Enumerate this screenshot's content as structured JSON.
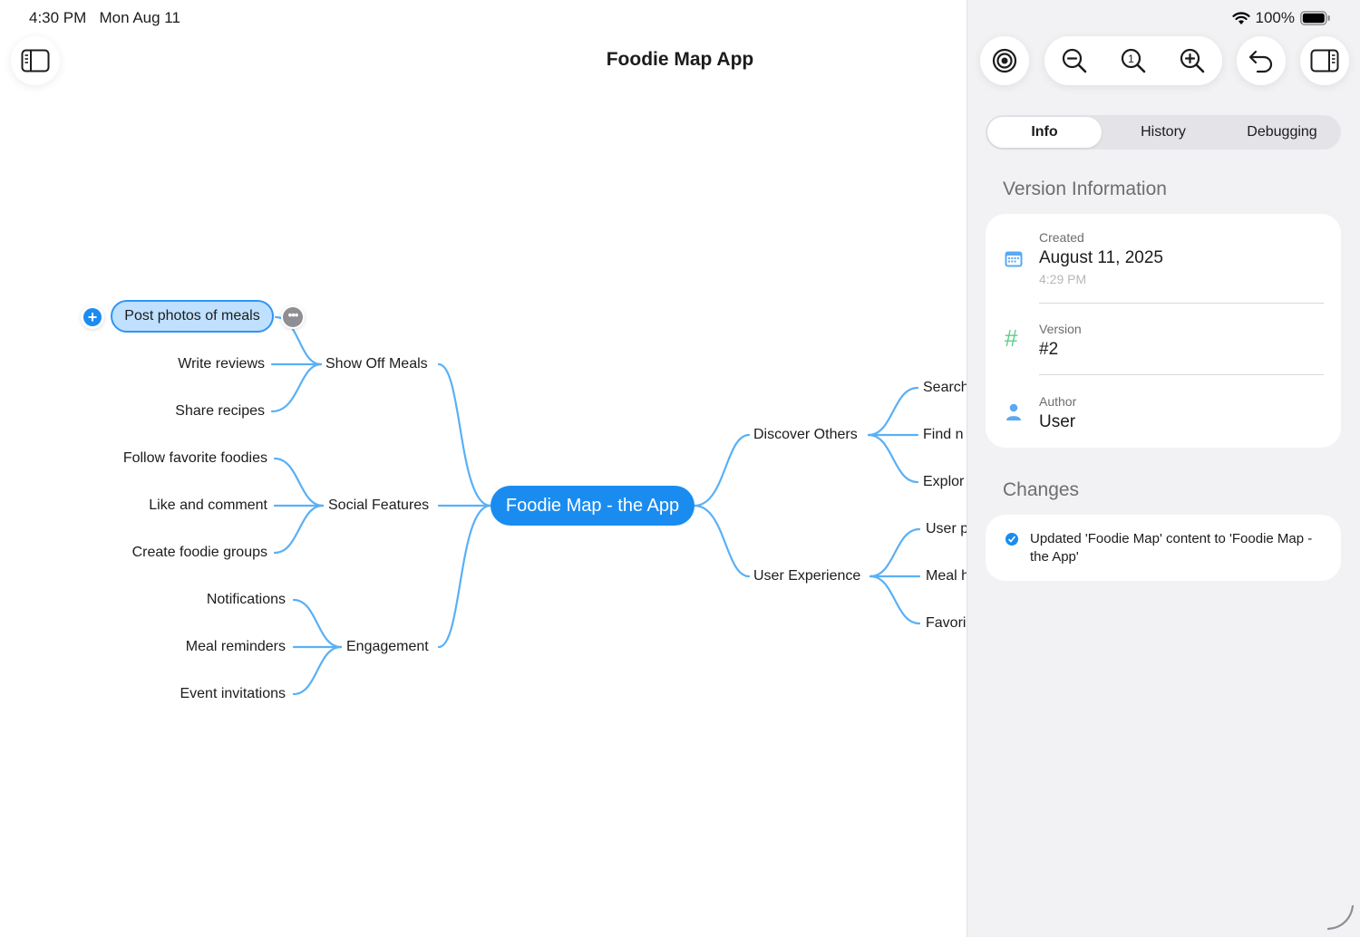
{
  "status_bar": {
    "time": "4:30 PM",
    "date": "Mon Aug 11",
    "battery": "100%"
  },
  "toolbar": {
    "left_icon": "sidebar-icon",
    "title": "Foodie Map App",
    "right_icons": [
      "focus-target-icon",
      "zoom-out-icon",
      "zoom-actual-size-icon",
      "zoom-in-icon",
      "undo-icon",
      "inspector-panel-icon"
    ]
  },
  "mindmap": {
    "central": "Foodie Map - the App",
    "left": [
      {
        "label": "Show Off Meals",
        "children": [
          "Post photos of meals",
          "Write reviews",
          "Share recipes"
        ]
      },
      {
        "label": "Social Features",
        "children": [
          "Follow favorite foodies",
          "Like and comment",
          "Create foodie groups"
        ]
      },
      {
        "label": "Engagement",
        "children": [
          "Notifications",
          "Meal reminders",
          "Event invitations"
        ]
      }
    ],
    "right": [
      {
        "label": "Discover Others",
        "children": [
          "Search",
          "Find n",
          "Explor"
        ]
      },
      {
        "label": "User Experience",
        "children": [
          "User p",
          "Meal h",
          "Favori"
        ]
      }
    ],
    "selected": "Post photos of meals",
    "colors": {
      "accent": "#1a8cf0",
      "branch": "#5ab0f5",
      "selected_fill": "#bfe0ff"
    }
  },
  "panel": {
    "tabs": [
      "Info",
      "History",
      "Debugging"
    ],
    "active_tab": "Info",
    "version_section_title": "Version Information",
    "fields": {
      "created_label": "Created",
      "created_date": "August 11, 2025",
      "created_time": "4:29 PM",
      "version_label": "Version",
      "version_value": "#2",
      "author_label": "Author",
      "author_value": "User"
    },
    "changes_title": "Changes",
    "changes": [
      "Updated 'Foodie Map' content to 'Foodie Map - the App'"
    ]
  }
}
